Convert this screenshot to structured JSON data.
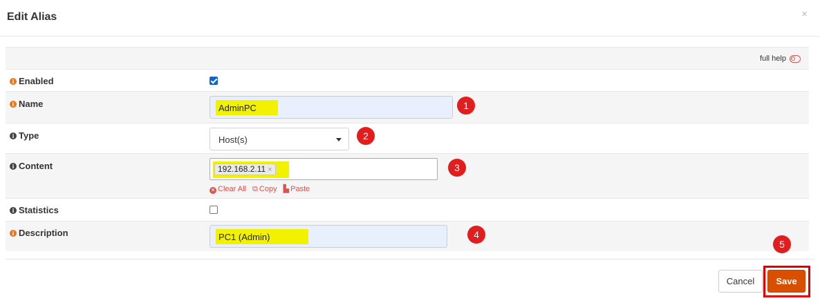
{
  "modal": {
    "title": "Edit Alias",
    "close": "×"
  },
  "help": {
    "label": "full help"
  },
  "fields": {
    "enabled": {
      "label": "Enabled",
      "checked": true
    },
    "name": {
      "label": "Name",
      "value": "AdminPC"
    },
    "type": {
      "label": "Type",
      "selected": "Host(s)"
    },
    "content": {
      "label": "Content",
      "token": "192.168.2.11",
      "token_remove": "×",
      "actions": {
        "clear_all": "Clear All",
        "copy": "Copy",
        "paste": "Paste"
      }
    },
    "statistics": {
      "label": "Statistics",
      "checked": false
    },
    "description": {
      "label": "Description",
      "value": "PC1 (Admin)"
    }
  },
  "annotations": [
    "1",
    "2",
    "3",
    "4",
    "5"
  ],
  "footer": {
    "cancel_label": "Cancel",
    "save_label": "Save"
  },
  "colors": {
    "accent": "#d94f00",
    "highlight": "#f2f200",
    "annotation": "#e11d1d",
    "link": "#d9534f"
  }
}
